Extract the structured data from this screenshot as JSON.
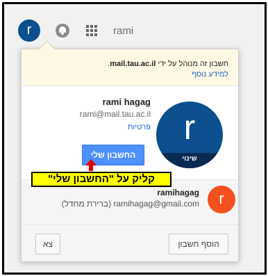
{
  "topbar": {
    "avatar_letter": "r",
    "user_label": "rami",
    "icons": [
      "notifications-icon",
      "apps-grid-icon"
    ]
  },
  "card": {
    "managed_text_prefix": "חשבון זה מנוהל על ידי ",
    "managed_domain": "mail.tau.ac.il",
    "managed_text_suffix": ".",
    "managed_link": "למידע נוסף",
    "profile": {
      "letter": "r",
      "change_label": "שינוי",
      "name": "rami hagag",
      "email": "rami@mail.tau.ac.il",
      "privacy_link": "פרטיות",
      "my_account_button": "החשבון שלי"
    },
    "annotation": "קליק על \"החשבון שלי\"",
    "other_account": {
      "letter": "r",
      "name": "ramihagag",
      "email": "ramihagag@gmail.com (ברירת מחדל)"
    },
    "footer": {
      "add_account": "הוסף חשבון",
      "sign_out": "צא"
    }
  },
  "colors": {
    "primary_blue": "#4d90fe",
    "avatar_blue": "#0b4f8f",
    "avatar_orange": "#f4511e",
    "annotation_yellow": "#ffff00",
    "arrow_red": "#e00000"
  }
}
